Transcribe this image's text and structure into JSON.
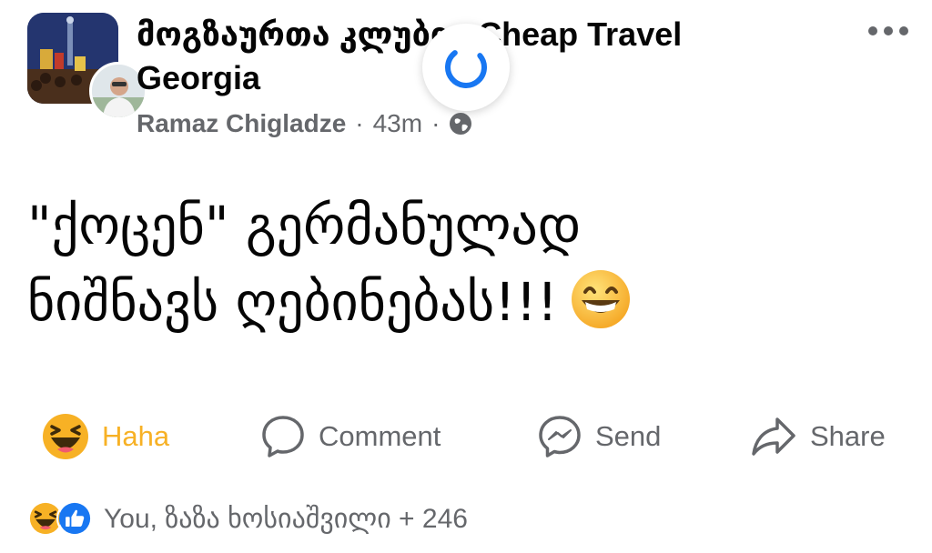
{
  "post": {
    "group_name": "მოგზაურთა კლუბი - Cheap Travel Georgia",
    "author": "Ramaz Chigladze",
    "separator": "·",
    "time": "43m",
    "audience_icon": "globe-icon",
    "body_line1": "\"ქოცენ\" გერმანულად",
    "body_line2": "ნიშნავს ღებინებას!!!",
    "body_emoji": "grinning-emoji"
  },
  "actions": {
    "haha_label": "Haha",
    "comment_label": "Comment",
    "send_label": "Send",
    "share_label": "Share"
  },
  "reactions": {
    "summary": "You, ზაზა ხოსიაშვილი + 246",
    "icons": [
      "haha-icon",
      "like-icon"
    ]
  },
  "colors": {
    "text": "#050505",
    "secondary_text": "#65676b",
    "haha": "#f7b125",
    "like": "#1877f2",
    "spinner": "#1877f2"
  }
}
